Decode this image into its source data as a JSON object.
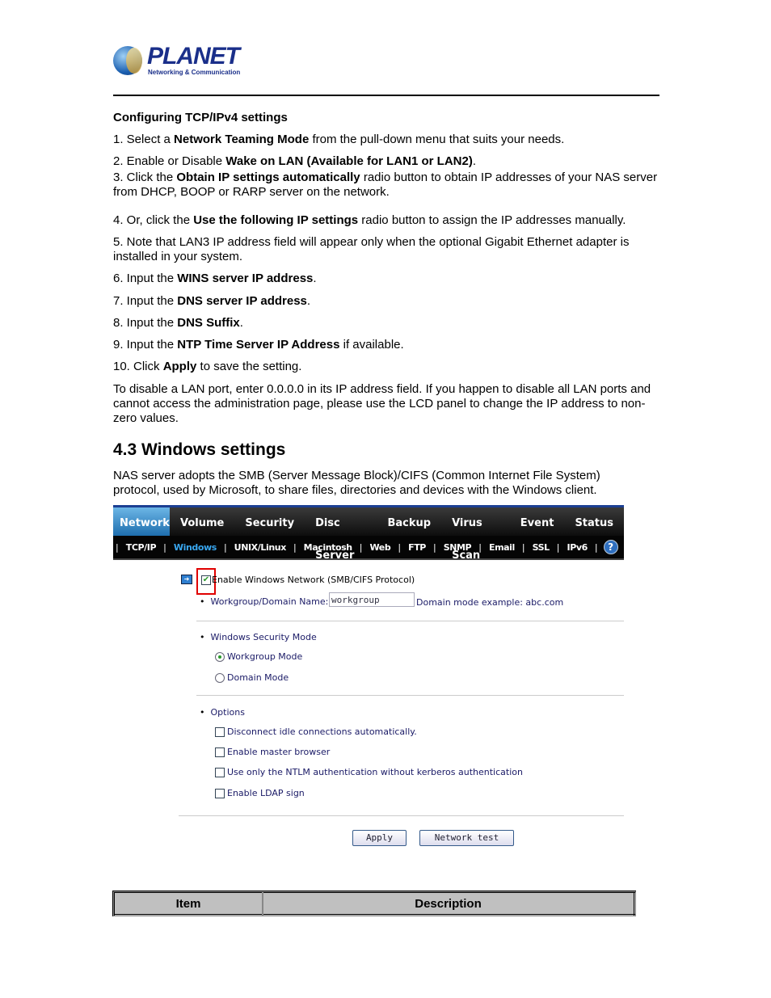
{
  "logo": {
    "word": "PLANET",
    "tagline": "Networking & Communication"
  },
  "section_heading": "Configuring TCP/IPv4 settings",
  "steps": [
    {
      "pre": "1. Select a ",
      "bold": "Network Teaming Mode",
      "post": " from the pull-down menu that suits your needs."
    },
    {
      "pre": "2. Enable or Disable ",
      "bold": "Wake on LAN (Available for LAN1 or LAN2)",
      "post": "."
    },
    {
      "pre": "3. Click the ",
      "bold": "Obtain IP settings automatically",
      "post": " radio button to obtain IP addresses of your NAS server from DHCP, BOOP or RARP server on the network."
    },
    {
      "pre": "4. Or, click the ",
      "bold": "Use the following IP settings",
      "post": " radio button to assign the IP addresses manually."
    },
    {
      "pre": "5. Note that LAN3 IP address field will appear only when the optional Gigabit Ethernet adapter is installed in your system.",
      "bold": "",
      "post": ""
    },
    {
      "pre": "6. Input the ",
      "bold": "WINS server IP address",
      "post": "."
    },
    {
      "pre": "7. Input the ",
      "bold": "DNS server IP address",
      "post": "."
    },
    {
      "pre": "8. Input the ",
      "bold": "DNS Suffix",
      "post": "."
    },
    {
      "pre": "9. Input the ",
      "bold": "NTP Time Server IP Address",
      "post": " if available."
    },
    {
      "pre": "10. Click ",
      "bold": "Apply",
      "post": " to save the setting."
    }
  ],
  "disable_note": "To disable a LAN port, enter 0.0.0.0 in its IP address field. If you happen to disable all LAN ports and cannot access the administration page, please use the LCD panel to change the IP address to non-zero values.",
  "heading": "4.3 Windows settings",
  "intro": "NAS server adopts the SMB (Server Message Block)/CIFS (Common Internet File System) protocol, used by Microsoft, to share files, directories and devices with the Windows client.",
  "ui": {
    "tabs": [
      "Network",
      "Volume",
      "Security",
      "Disc Server",
      "Backup",
      "Virus Scan",
      "Event",
      "Status"
    ],
    "subtabs": [
      "TCP/IP",
      "Windows",
      "UNIX/Linux",
      "Macintosh",
      "Web",
      "FTP",
      "SNMP",
      "Email",
      "SSL",
      "IPv6"
    ],
    "help": "?",
    "enable_label": "Enable Windows Network (SMB/CIFS Protocol)",
    "enable_checked": true,
    "workgroup_label": "Workgroup/Domain Name:",
    "workgroup_value": "workgroup",
    "domain_example": "Domain mode example: abc.com",
    "security_label": "Windows Security Mode",
    "modes": [
      "Workgroup Mode",
      "Domain Mode"
    ],
    "selected_mode": "Workgroup Mode",
    "options_label": "Options",
    "options": [
      "Disconnect idle connections automatically.",
      "Enable master browser",
      "Use only the NTLM authentication without kerberos authentication",
      "Enable LDAP sign"
    ],
    "apply": "Apply",
    "network_test": "Network test",
    "highlight_color": "#e00000",
    "active_color": "#39a7f0"
  },
  "table": {
    "headers": [
      "Item",
      "Description"
    ]
  }
}
